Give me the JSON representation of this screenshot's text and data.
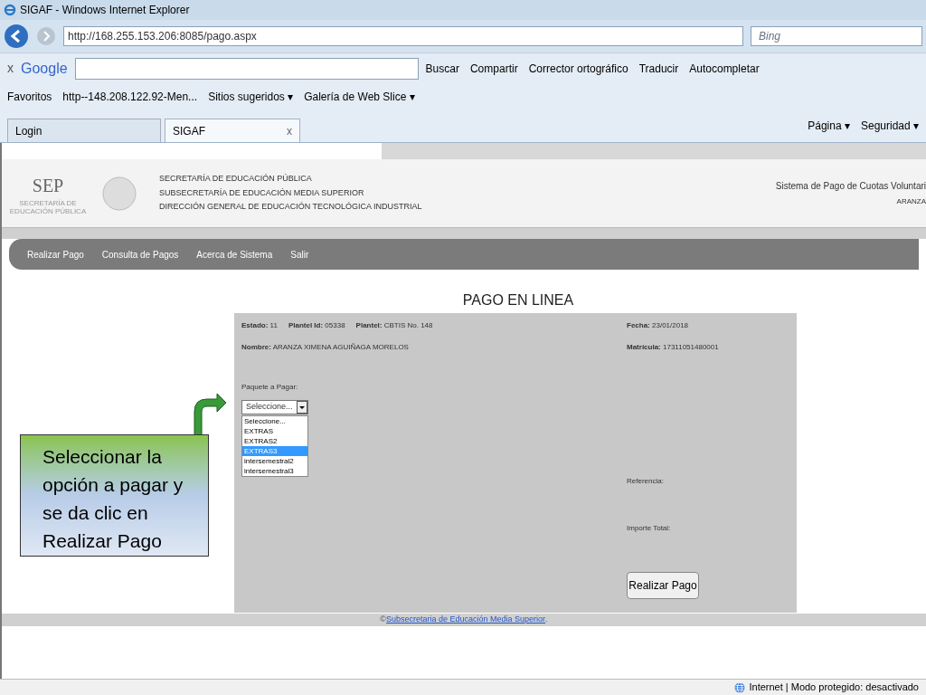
{
  "window": {
    "title": "SIGAF - Windows Internet Explorer"
  },
  "address_bar": {
    "url": "http://168.255.153.206:8085/pago.aspx",
    "search_placeholder": "Bing"
  },
  "google_bar": {
    "close": "x",
    "logo": "Google",
    "items": [
      "Buscar",
      "Compartir",
      "Corrector ortográfico",
      "Traducir",
      "Autocompletar"
    ]
  },
  "favorites_bar": {
    "items": [
      "Favoritos",
      "http--148.208.122.92-Men...",
      "Sitios sugeridos ▾",
      "Galería de Web Slice ▾"
    ]
  },
  "tabs": [
    {
      "label": "Login",
      "selected": false
    },
    {
      "label": "SIGAF",
      "selected": true,
      "close": "x"
    }
  ],
  "command_bar": [
    "Página ▾",
    "Seguridad ▾"
  ],
  "header": {
    "logo": "SEP",
    "logo_sub": "SECRETARÍA DE EDUCACIÓN PÚBLICA",
    "lines": [
      "SECRETARÍA DE EDUCACIÓN PÚBLICA",
      "SUBSECRETARÍA DE EDUCACIÓN MEDIA SUPERIOR",
      "DIRECCIÓN GENERAL DE EDUCACIÓN TECNOLÓGICA INDUSTRIAL"
    ],
    "system": "Sistema de Pago de Cuotas Voluntari",
    "user": "ARANZA"
  },
  "menu": [
    "Realizar Pago",
    "Consulta de Pagos",
    "Acerca de Sistema",
    "Salir"
  ],
  "page_title": "PAGO EN LINEA",
  "info_left": [
    "**Estado:** 11",
    "**Plantel Id:** 05338",
    "**Plantel:** CBTIS No. 148"
  ],
  "name": "**Nombre:** ARANZA XIMENA AGUIÑAGA MORELOS",
  "fecha": "**Fecha:** 23/01/2018",
  "matricula": "**Matrícula:** 17311051480001",
  "paquete": {
    "label": "Paquete a Pagar:",
    "value": "Seleccione...",
    "options": [
      {
        "label": "Seleccione...",
        "highlighted": false
      },
      {
        "label": "EXTRAS",
        "highlighted": false
      },
      {
        "label": "EXTRAS2",
        "highlighted": false
      },
      {
        "label": "EXTRAS3",
        "highlighted": true
      },
      {
        "label": "intersemestral2",
        "highlighted": false
      },
      {
        "label": "intersemestral3",
        "highlighted": false
      }
    ]
  },
  "referencia": "Referencia:",
  "importe": "Importe Total:",
  "pay_button": "Realizar Pago",
  "callout": "Seleccionar la opción a pagar y se da clic en Realizar Pago",
  "footer": {
    "prefix": "©",
    "link": "Subsecretaria de Educación Media Superior",
    "suffix": "."
  },
  "status_bar": "Internet | Modo protegido: desactivado"
}
